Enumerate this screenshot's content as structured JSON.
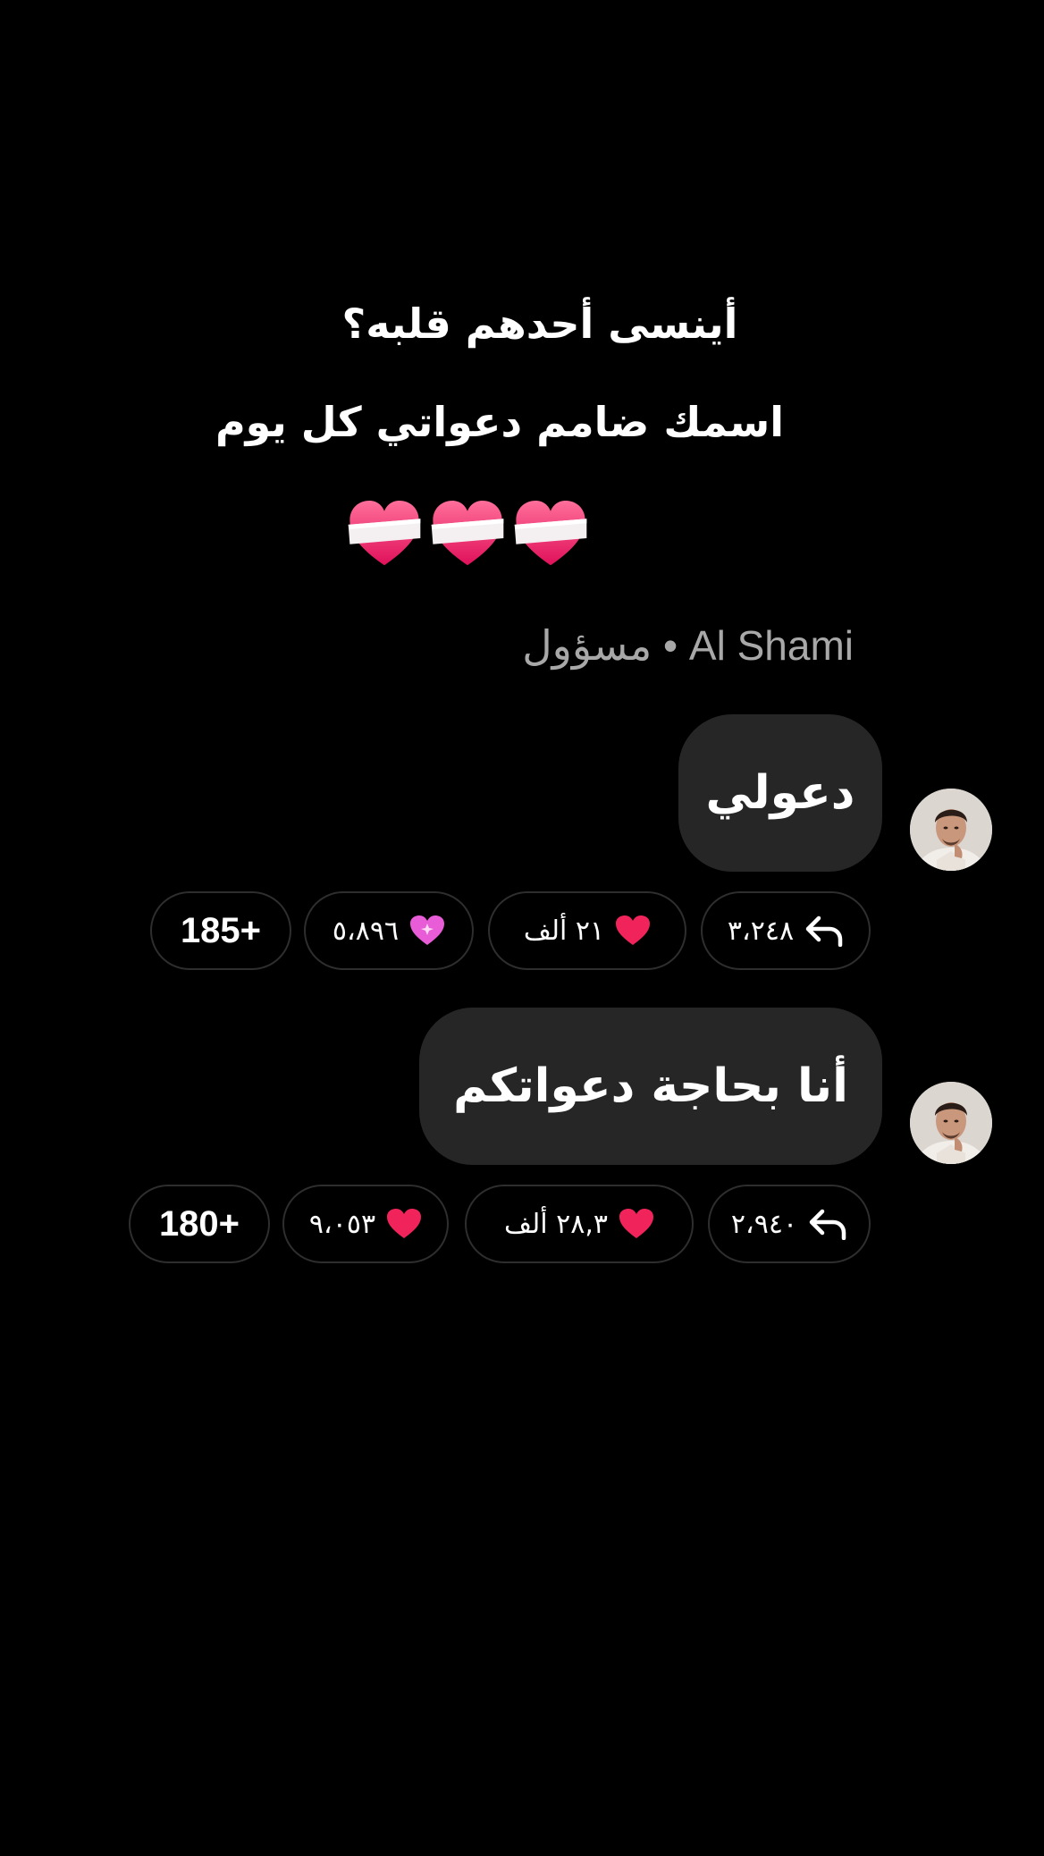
{
  "caption": {
    "line1": "أينسى أحدهم قلبه؟",
    "line2": "اسمك ضامم دعواتي كل يوم",
    "hearts_icon": "mending-heart-icon",
    "hearts_count": 3
  },
  "sender": {
    "name": "Al Shami",
    "separator": "•",
    "role": "مسؤول",
    "label": "مسؤول • Al Shami"
  },
  "messages": [
    {
      "text": "دعولي",
      "reactions": {
        "replies": "٣،٢٤٨",
        "red_heart": "٢١ ألف",
        "pink_heart": "٥،٨٩٦",
        "more": "185+"
      }
    },
    {
      "text": "أنا بحاجة دعواتكم",
      "reactions": {
        "replies": "٢،٩٤٠",
        "red_heart": "٢٨,٣ ألف",
        "pink_heart": "٩،٠٥٣",
        "more": "180+"
      }
    }
  ],
  "colors": {
    "background": "#000000",
    "bubble": "#262626",
    "sender_text": "#a8a8a8",
    "pill_border": "#2e2e2e",
    "red_heart": "#f0245a",
    "pink_heart": "#e85cd8"
  }
}
